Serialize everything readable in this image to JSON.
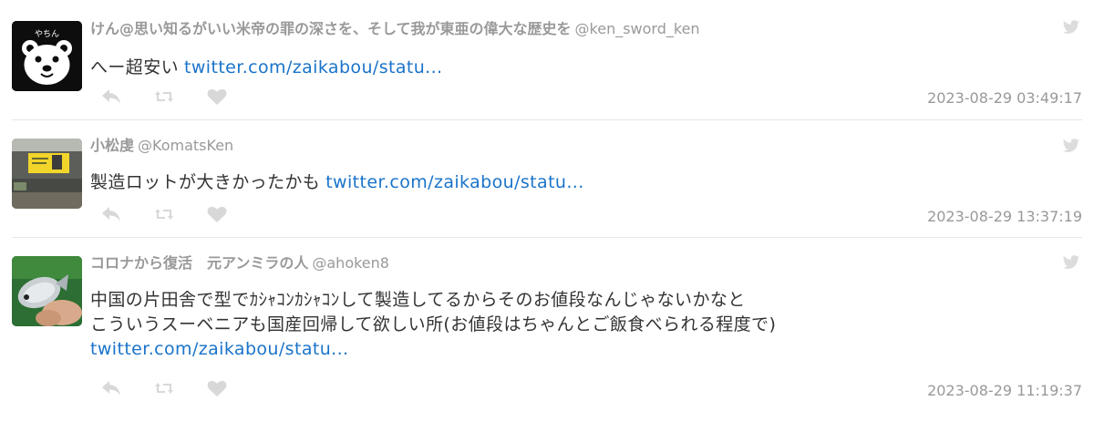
{
  "tweets": [
    {
      "display_name": "けん@思い知るがいい米帝の罪の深さを、そして我が東亜の偉大な歴史を",
      "handle": "@ken_sword_ken",
      "text": "へー超安い",
      "link": "twitter.com/zaikabou/statu...",
      "timestamp": "2023-08-29 03:49:17",
      "avatar_icon": "white-bear-face-icon",
      "avatar_text": "やちん"
    },
    {
      "display_name": "小松虔",
      "handle": "@KomatsKen",
      "text": "製造ロットが大きかったかも",
      "link": "twitter.com/zaikabou/statu...",
      "timestamp": "2023-08-29 13:37:19",
      "avatar_icon": "yellow-sign-photo-icon"
    },
    {
      "display_name": "コロナから復活　元アンミラの人",
      "handle": "@ahoken8",
      "text_lines": [
        "中国の片田舎で型でｶｼｬｺﾝｶｼｬｺﾝして製造してるからそのお値段なんじゃないかなと",
        "こういうスーベニアも国産回帰して欲しい所(お値段はちゃんとご飯食べられる程度で)"
      ],
      "link": "twitter.com/zaikabou/statu...",
      "timestamp": "2023-08-29 11:19:37",
      "avatar_icon": "fish-in-hand-photo-icon"
    }
  ],
  "icons": {
    "reply": "reply-icon",
    "retweet": "retweet-icon",
    "like": "heart-icon",
    "brand": "twitter-bird-icon"
  },
  "colors": {
    "link": "#1a73c9",
    "muted": "#999999",
    "action_icon": "#d8d8d8",
    "divider": "#e6e6e6"
  }
}
